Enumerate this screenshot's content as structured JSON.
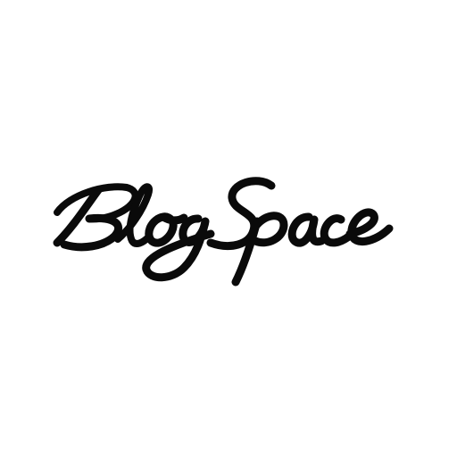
{
  "logo": {
    "wordmark": "BlogSpace",
    "color": "#0a0a0a",
    "background": "#ffffff"
  }
}
